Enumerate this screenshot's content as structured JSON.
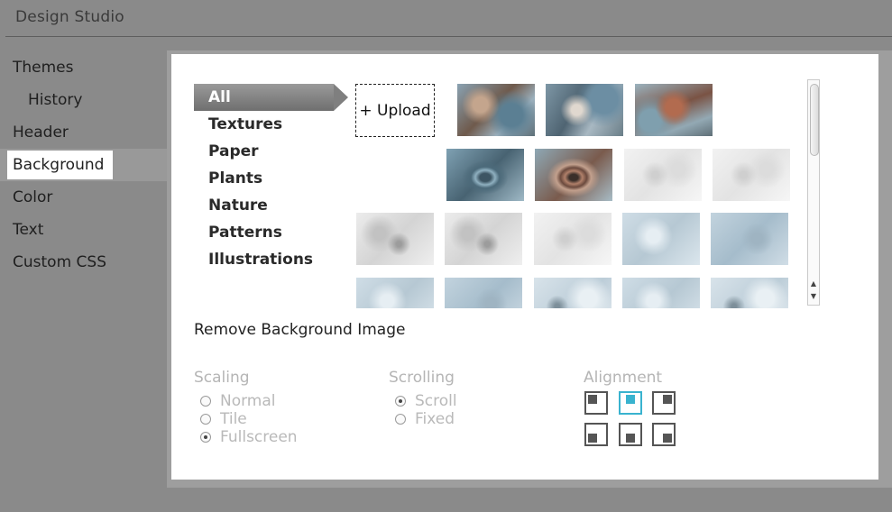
{
  "app": {
    "title": "Design Studio"
  },
  "nav": {
    "items": [
      {
        "label": "Themes"
      },
      {
        "label": "History"
      },
      {
        "label": "Header"
      },
      {
        "label": "Background"
      },
      {
        "label": "Color"
      },
      {
        "label": "Text"
      },
      {
        "label": "Custom CSS"
      }
    ],
    "active": "Background"
  },
  "categories": [
    {
      "label": "All"
    },
    {
      "label": "Textures"
    },
    {
      "label": "Paper"
    },
    {
      "label": "Plants"
    },
    {
      "label": "Nature"
    },
    {
      "label": "Patterns"
    },
    {
      "label": "Illustrations"
    }
  ],
  "upload": {
    "label": "+ Upload"
  },
  "thumbnails": [
    {
      "style": "bark-rust"
    },
    {
      "style": "bark-blue"
    },
    {
      "style": "bark-red"
    },
    {
      "style": "wood-knot-blue"
    },
    {
      "style": "wood-knot-rust"
    },
    {
      "style": "paper-grey-light"
    },
    {
      "style": "paper-grey-light"
    },
    {
      "style": "paper-grey"
    },
    {
      "style": "paper-grey"
    },
    {
      "style": "paper-grey-light"
    },
    {
      "style": "paper-blue-pale"
    },
    {
      "style": "paper-blue"
    },
    {
      "style": "paper-blue-pale"
    },
    {
      "style": "paper-blue"
    },
    {
      "style": "paper-blue-light"
    },
    {
      "style": "paper-blue-pale"
    },
    {
      "style": "paper-blue-light"
    }
  ],
  "remove_link": "Remove Background Image",
  "scaling": {
    "title": "Scaling",
    "options": [
      "Normal",
      "Tile",
      "Fullscreen"
    ],
    "selected": "Fullscreen"
  },
  "scrolling": {
    "title": "Scrolling",
    "options": [
      "Scroll",
      "Fixed"
    ],
    "selected": "Scroll"
  },
  "alignment": {
    "title": "Alignment",
    "positions": [
      "top-left",
      "top-center",
      "top-right",
      "bottom-left",
      "bottom-center",
      "bottom-right"
    ],
    "selected": "top-center"
  },
  "colors": {
    "accent": "#39b3cf",
    "background": "#8a8a8a",
    "panel": "#ffffff"
  }
}
